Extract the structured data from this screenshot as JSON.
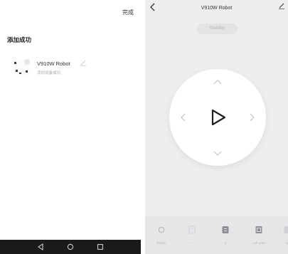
{
  "left_screen": {
    "done_label": "完成",
    "title": "添加成功",
    "device": {
      "name": "V910W Robot",
      "subtitle": "添加设备成功"
    }
  },
  "right_screen": {
    "title": "V910W Robot",
    "status": "Standby",
    "controls": [
      {
        "label": "Switch",
        "icon": "power-icon"
      },
      {
        "label": "~",
        "icon": "box-icon"
      },
      {
        "label": "2",
        "icon": "box-icon"
      },
      {
        "label": "Left area",
        "icon": "box-icon"
      },
      {
        "label": "rig",
        "icon": "box-icon"
      }
    ]
  },
  "colors": {
    "panel_bg": "#eeeeef",
    "dpad_bg": "#ffffff",
    "navbar_bg": "#1b1b1b",
    "muted_text": "#b2b2b8"
  }
}
